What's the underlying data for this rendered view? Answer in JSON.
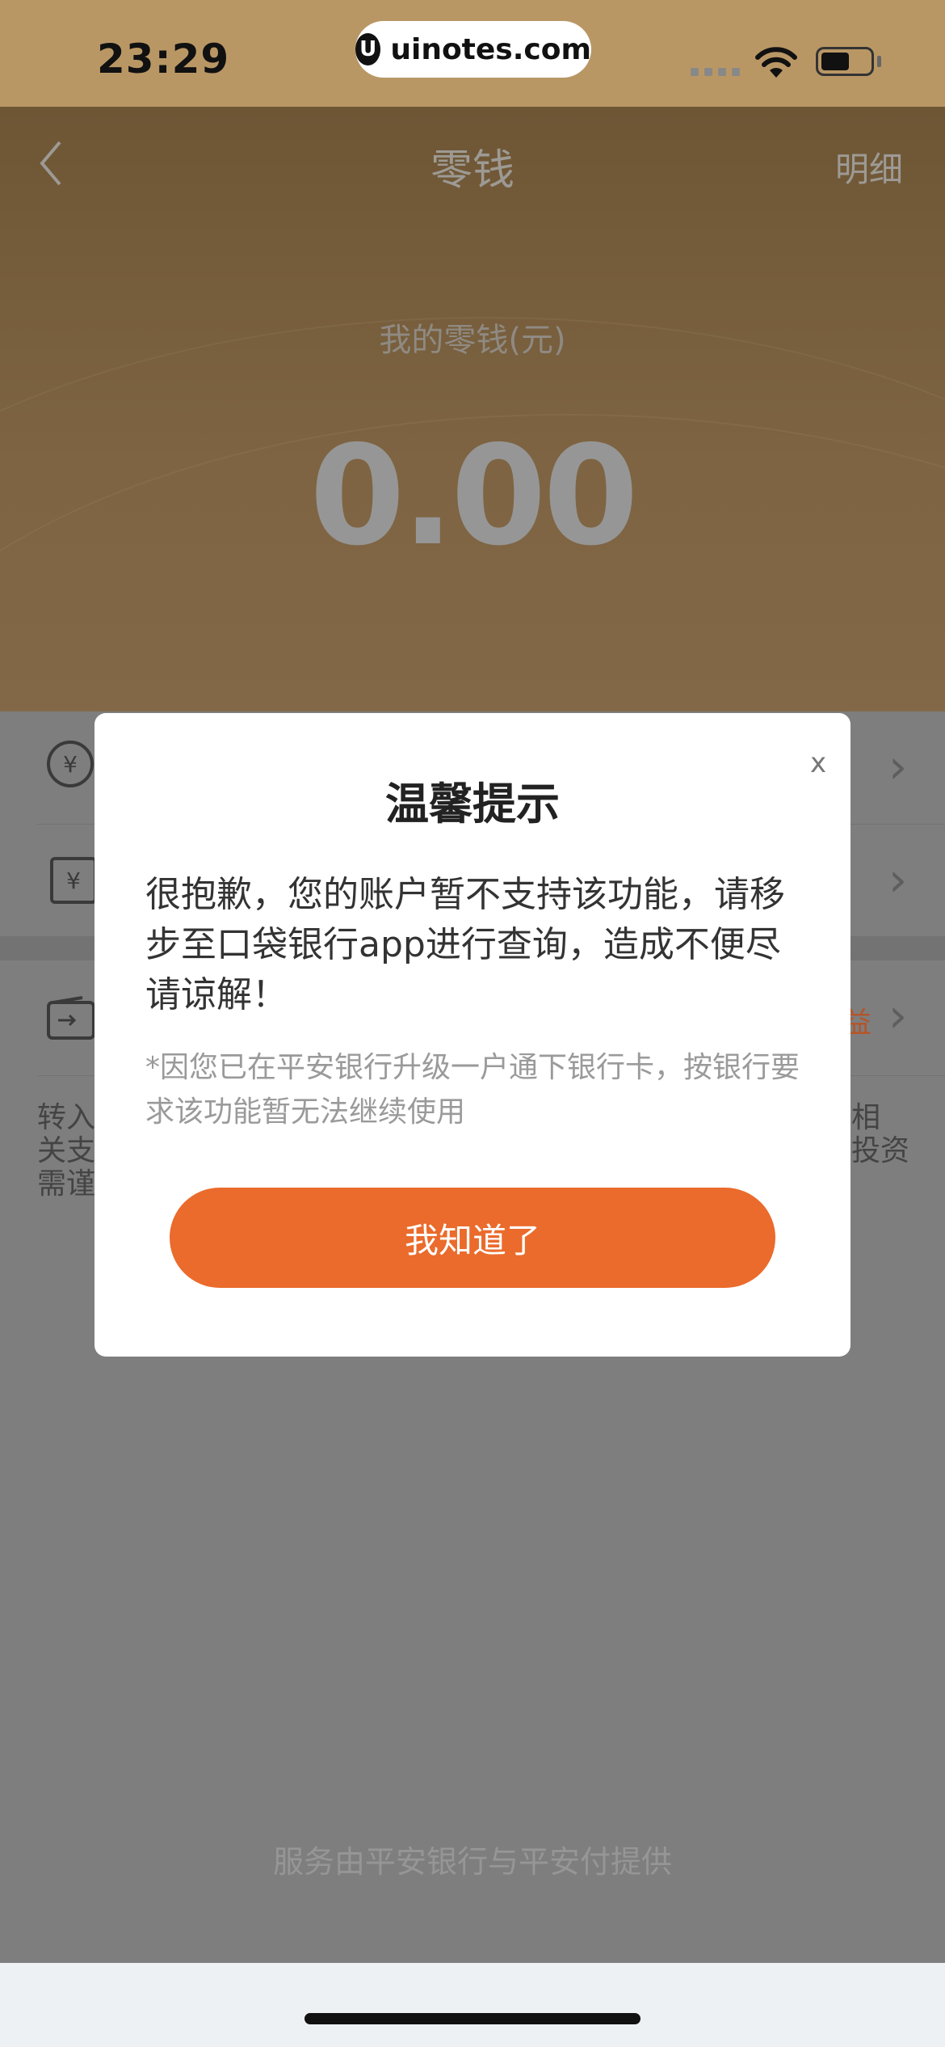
{
  "status_bar": {
    "time": "23:29",
    "url": "uinotes.com"
  },
  "nav": {
    "title": "零钱",
    "detail": "明细"
  },
  "balance": {
    "label": "我的零钱(元)",
    "value": "0.00"
  },
  "rows": [
    {
      "icon": "¥"
    },
    {
      "icon": "¥"
    },
    {
      "icon": "",
      "trailing_text": "益"
    }
  ],
  "notice": {
    "left_lines": [
      "转入",
      "关支",
      "需谨"
    ],
    "right_lines": [
      "相",
      "投资"
    ]
  },
  "footer": "服务由平安银行与平安付提供",
  "modal": {
    "title": "温馨提示",
    "body": "很抱歉，您的账户暂不支持该功能，请移步至口袋银行app进行查询，造成不便尽请谅解！",
    "note": "*因您已在平安银行升级一户通下银行卡，按银行要求该功能暂无法继续使用",
    "button": "我知道了",
    "close": "x"
  }
}
